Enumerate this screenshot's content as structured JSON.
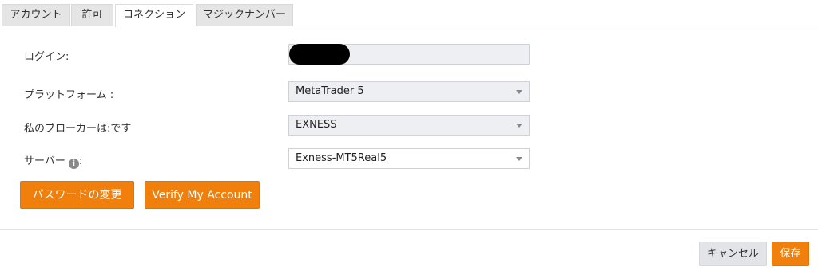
{
  "tabs": [
    {
      "label": "アカウント",
      "active": false
    },
    {
      "label": "許可",
      "active": false
    },
    {
      "label": "コネクション",
      "active": true
    },
    {
      "label": "マジックナンバー",
      "active": false
    }
  ],
  "form": {
    "login": {
      "label": "ログイン:",
      "value": ""
    },
    "platform": {
      "label": "プラットフォーム :",
      "value": "MetaTrader 5"
    },
    "broker": {
      "label": "私のブローカーは:です",
      "value": "EXNESS"
    },
    "server": {
      "label": "サーバー",
      "label_suffix": ":",
      "value": "Exness-MT5Real5",
      "info_icon": "info-icon"
    }
  },
  "buttons": {
    "change_password": "パスワードの変更",
    "verify_account": "Verify My Account",
    "cancel": "キャンセル",
    "save": "保存"
  },
  "colors": {
    "accent": "#f07f0c",
    "field_bg": "#eeeff3",
    "secondary_button": "#e3e4e8"
  }
}
